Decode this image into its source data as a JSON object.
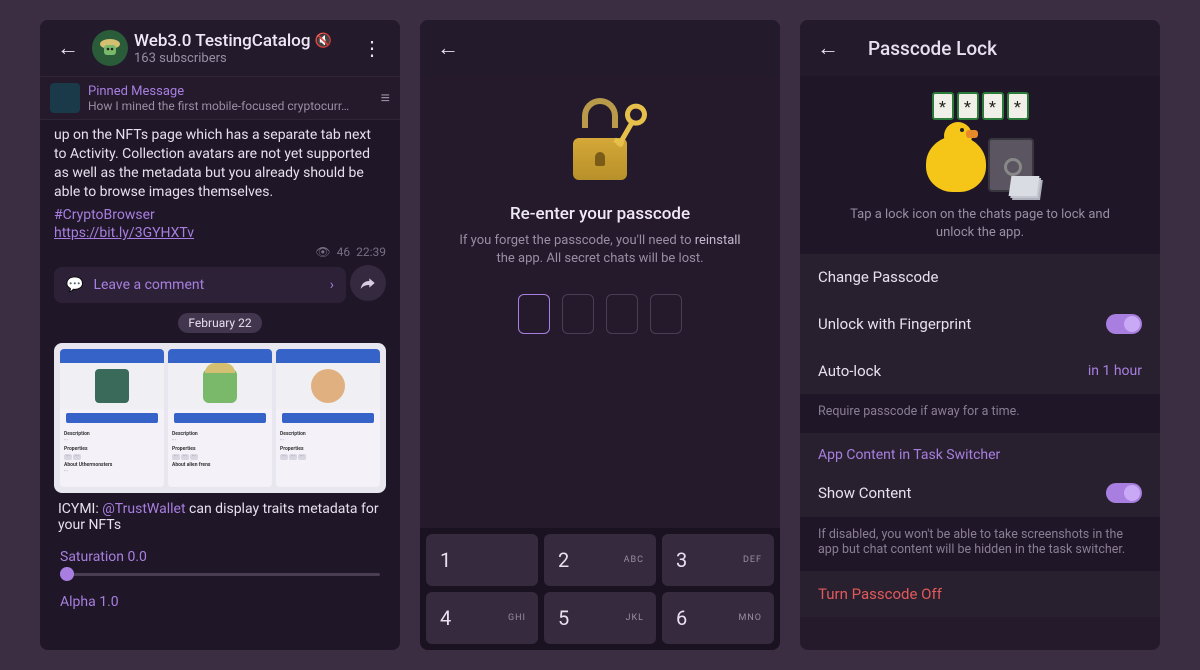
{
  "screen1": {
    "chat_title": "Web3.0 TestingCatalog",
    "subscribers": "163 subscribers",
    "pinned_label": "Pinned Message",
    "pinned_preview": "How I mined the first mobile-focused cryptocurr…",
    "msg_body": "up on the NFTs page which has a separate tab next to Activity. Collection avatars are not yet supported as well as the metadata but you already should be able to browse images themselves.",
    "hashtag": "#CryptoBrowser",
    "link": "https://bit.ly/3GYHXTv",
    "views": "46",
    "time": "22:39",
    "comment_label": "Leave a comment",
    "date": "February 22",
    "caption_pre": "ICYMI: ",
    "caption_mention": "@TrustWallet",
    "caption_post": " can display traits metadata for your NFTs",
    "slider1": "Saturation 0.0",
    "slider2": "Alpha 1.0"
  },
  "screen2": {
    "title": "Re-enter your passcode",
    "sub_a": "If you forget the passcode, you'll need to ",
    "sub_bold": "reinstall",
    "sub_b": " the app. All secret chats will be lost.",
    "keys": [
      {
        "n": "1",
        "a": ""
      },
      {
        "n": "2",
        "a": "ABC"
      },
      {
        "n": "3",
        "a": "DEF"
      },
      {
        "n": "4",
        "a": "GHI"
      },
      {
        "n": "5",
        "a": "JKL"
      },
      {
        "n": "6",
        "a": "MNO"
      }
    ]
  },
  "screen3": {
    "title": "Passcode Lock",
    "hint": "Tap a lock icon on the chats page to lock and unlock the app.",
    "row_change": "Change Passcode",
    "row_fingerprint": "Unlock with Fingerprint",
    "row_autolock": "Auto-lock",
    "autolock_value": "in 1 hour",
    "footer1": "Require passcode if away for a time.",
    "section2": "App Content in Task Switcher",
    "row_showcontent": "Show Content",
    "footer2": "If disabled, you won't be able to take screenshots in the app but chat content will be hidden in the task switcher.",
    "row_off": "Turn Passcode Off"
  }
}
